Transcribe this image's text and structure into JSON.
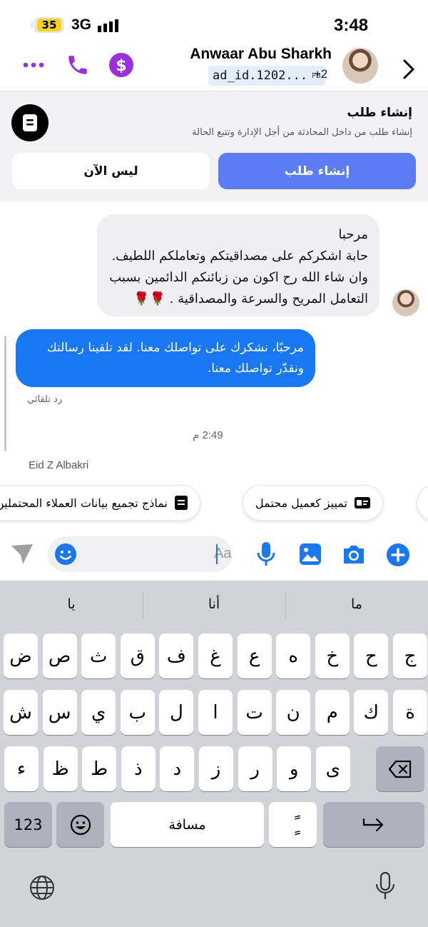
{
  "status_bar": {
    "battery": "35",
    "network": "3G",
    "time": "3:48"
  },
  "header": {
    "contact_name": "Anwaar Abu Sharkh",
    "ad_id": "ad_id.1202...",
    "source_badge": "FB",
    "extra_count": "+2",
    "accent_color": "#9b2fe0"
  },
  "request_panel": {
    "title": "إنشاء طلب",
    "subtitle": "إنشاء طلب من داخل المحادثة من أجل الإدارة وتتبع الحالة",
    "create_button": "إنشاء طلب",
    "later_button": "ليس الآن"
  },
  "messages": [
    {
      "direction": "incoming",
      "lines": [
        "مرحبا",
        "حابة اشكركم على مصداقيتكم وتعاملكم اللطيف.",
        "وان شاء الله رح اكون من زبائنكم الدائمين بسبب",
        "التعامل المريح والسرعة والمصداقية . 🌹🌹"
      ]
    },
    {
      "direction": "outgoing",
      "lines": [
        "مرحبًا، نشكرك على تواصلك معنا. لقد تلقينا رسالتك",
        "ونقدّر تواصلك معنا."
      ],
      "label": "رد تلقائي"
    }
  ],
  "timestamp": "2:49 م",
  "agent_name": "Eid Z Albakri",
  "quick_actions": [
    "تمييز كعميل محتمل",
    "نماذج تجميع بيانات العملاء المحتملين"
  ],
  "composer": {
    "placeholder": "Aa"
  },
  "keyboard": {
    "suggestions": [
      "ما",
      "أنا",
      "يا"
    ],
    "row1": [
      "ج",
      "ح",
      "خ",
      "ه",
      "ع",
      "غ",
      "ف",
      "ق",
      "ث",
      "ص",
      "ض"
    ],
    "row2": [
      "ة",
      "ك",
      "م",
      "ن",
      "ت",
      "ا",
      "ل",
      "ب",
      "ي",
      "س",
      "ش"
    ],
    "row3": [
      "ى",
      "و",
      "ر",
      "ز",
      "د",
      "ذ",
      "ط",
      "ظ",
      "ء"
    ],
    "numbers_key": "123",
    "space_key": "مسافة",
    "diacritic_key": "ًٍ"
  }
}
